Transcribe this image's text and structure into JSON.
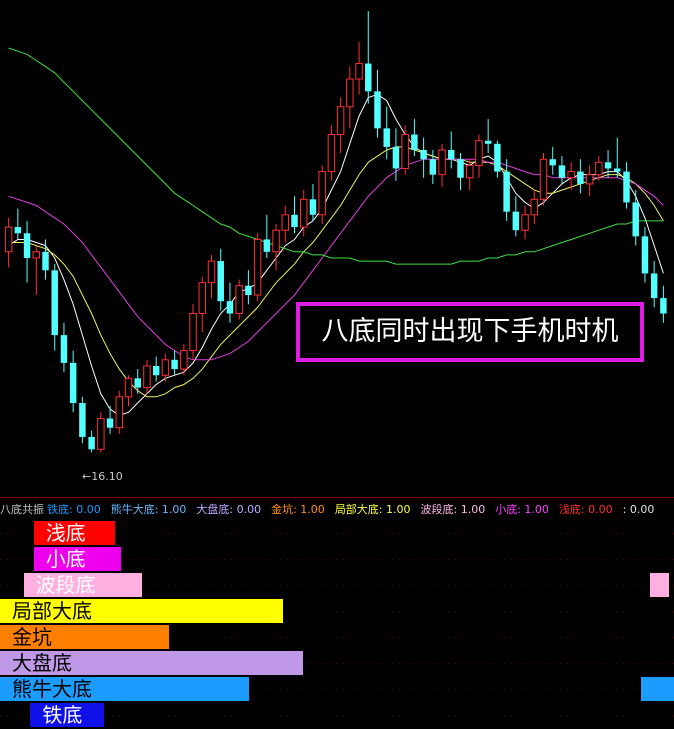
{
  "chart_data": {
    "type": "candlestick",
    "y_range": [
      15.4,
      30.5
    ],
    "candles": [
      [
        22.6,
        23.7,
        22.1,
        23.4
      ],
      [
        23.4,
        24.0,
        23.0,
        23.2
      ],
      [
        23.2,
        23.6,
        21.6,
        22.4
      ],
      [
        22.4,
        22.8,
        21.2,
        22.6
      ],
      [
        22.6,
        23.0,
        21.7,
        22.0
      ],
      [
        22.0,
        22.2,
        19.4,
        19.9
      ],
      [
        19.9,
        20.3,
        18.7,
        19.0
      ],
      [
        19.0,
        19.4,
        17.4,
        17.7
      ],
      [
        17.7,
        17.9,
        16.4,
        16.6
      ],
      [
        16.6,
        16.8,
        16.1,
        16.2
      ],
      [
        16.2,
        17.4,
        16.1,
        17.2
      ],
      [
        17.2,
        17.6,
        16.7,
        16.9
      ],
      [
        16.9,
        18.1,
        16.7,
        17.9
      ],
      [
        17.9,
        18.6,
        17.6,
        18.5
      ],
      [
        18.5,
        18.8,
        18.0,
        18.2
      ],
      [
        18.2,
        19.1,
        18.0,
        18.9
      ],
      [
        18.9,
        19.2,
        18.4,
        18.6
      ],
      [
        18.6,
        19.3,
        18.4,
        19.1
      ],
      [
        19.1,
        19.4,
        18.6,
        18.8
      ],
      [
        18.8,
        19.6,
        18.6,
        19.4
      ],
      [
        19.4,
        20.9,
        19.1,
        20.6
      ],
      [
        20.6,
        21.8,
        20.0,
        21.6
      ],
      [
        21.6,
        22.5,
        21.1,
        22.3
      ],
      [
        22.3,
        22.7,
        20.7,
        21.0
      ],
      [
        21.0,
        21.6,
        20.3,
        20.6
      ],
      [
        20.6,
        21.7,
        20.4,
        21.5
      ],
      [
        21.5,
        22.0,
        20.9,
        21.2
      ],
      [
        21.2,
        23.2,
        21.0,
        23.0
      ],
      [
        23.0,
        23.8,
        22.4,
        22.6
      ],
      [
        22.6,
        23.5,
        22.0,
        23.3
      ],
      [
        23.3,
        24.1,
        22.9,
        23.8
      ],
      [
        23.8,
        24.4,
        23.2,
        23.4
      ],
      [
        23.4,
        24.6,
        23.1,
        24.3
      ],
      [
        24.3,
        24.8,
        23.6,
        23.8
      ],
      [
        23.8,
        25.4,
        23.5,
        25.2
      ],
      [
        25.2,
        26.7,
        24.9,
        26.4
      ],
      [
        26.4,
        27.6,
        25.8,
        27.3
      ],
      [
        27.3,
        28.6,
        26.6,
        28.2
      ],
      [
        28.2,
        29.4,
        27.7,
        28.7
      ],
      [
        28.7,
        30.4,
        27.4,
        27.8
      ],
      [
        27.8,
        28.5,
        26.3,
        26.6
      ],
      [
        26.6,
        27.3,
        25.6,
        26.0
      ],
      [
        26.0,
        26.6,
        24.9,
        25.3
      ],
      [
        25.3,
        26.7,
        25.1,
        26.4
      ],
      [
        26.4,
        26.9,
        25.7,
        25.9
      ],
      [
        25.9,
        26.3,
        25.0,
        25.6
      ],
      [
        25.6,
        25.9,
        24.8,
        25.1
      ],
      [
        25.1,
        26.1,
        24.7,
        25.9
      ],
      [
        25.9,
        26.5,
        25.3,
        25.6
      ],
      [
        25.6,
        25.8,
        24.6,
        25.0
      ],
      [
        25.0,
        25.6,
        24.6,
        25.4
      ],
      [
        25.4,
        26.4,
        25.0,
        26.2
      ],
      [
        26.2,
        26.9,
        25.8,
        26.1
      ],
      [
        26.1,
        26.2,
        25.0,
        25.2
      ],
      [
        25.2,
        25.6,
        23.6,
        23.9
      ],
      [
        23.9,
        24.4,
        23.1,
        23.3
      ],
      [
        23.3,
        24.1,
        23.0,
        23.8
      ],
      [
        23.8,
        24.6,
        23.5,
        24.3
      ],
      [
        24.3,
        25.8,
        24.1,
        25.6
      ],
      [
        25.6,
        26.0,
        25.1,
        25.4
      ],
      [
        25.4,
        25.7,
        24.8,
        25.0
      ],
      [
        25.0,
        25.5,
        24.6,
        25.2
      ],
      [
        25.2,
        25.6,
        24.5,
        24.8
      ],
      [
        24.8,
        25.4,
        24.4,
        25.1
      ],
      [
        25.1,
        25.7,
        24.9,
        25.5
      ],
      [
        25.5,
        25.9,
        25.0,
        25.3
      ],
      [
        25.3,
        26.3,
        25.0,
        25.2
      ],
      [
        25.2,
        25.5,
        24.0,
        24.2
      ],
      [
        24.2,
        24.6,
        22.8,
        23.1
      ],
      [
        23.1,
        23.4,
        21.6,
        21.9
      ],
      [
        21.9,
        22.3,
        20.8,
        21.1
      ],
      [
        21.1,
        21.5,
        20.3,
        20.6
      ]
    ],
    "ma_lines": [
      {
        "color": "#ffffff",
        "values": [
          22.8,
          23.0,
          23.0,
          22.9,
          22.8,
          22.4,
          21.7,
          20.9,
          19.9,
          18.9,
          18.0,
          17.5,
          17.3,
          17.4,
          17.7,
          18.0,
          18.3,
          18.5,
          18.6,
          18.7,
          19.0,
          19.5,
          20.1,
          20.6,
          20.9,
          21.3,
          21.4,
          21.6,
          22.0,
          22.4,
          22.8,
          23.0,
          23.4,
          23.6,
          24.0,
          24.6,
          25.2,
          26.1,
          27.0,
          27.6,
          27.7,
          27.5,
          26.9,
          26.4,
          26.0,
          25.8,
          25.7,
          25.6,
          25.6,
          25.5,
          25.4,
          25.6,
          25.7,
          25.5,
          25.0,
          24.5,
          24.2,
          24.0,
          24.2,
          24.5,
          24.8,
          25.0,
          25.1,
          25.1,
          25.1,
          25.2,
          25.2,
          24.9,
          24.4,
          23.7,
          22.8,
          21.9
        ]
      },
      {
        "color": "#f0f060",
        "values": [
          22.9,
          22.9,
          22.9,
          22.8,
          22.7,
          22.5,
          22.2,
          21.8,
          21.2,
          20.6,
          19.9,
          19.3,
          18.8,
          18.4,
          18.1,
          17.9,
          17.9,
          18.0,
          18.2,
          18.3,
          18.5,
          18.8,
          19.2,
          19.6,
          19.9,
          20.2,
          20.5,
          20.8,
          21.2,
          21.6,
          21.9,
          22.2,
          22.6,
          22.9,
          23.3,
          23.7,
          24.1,
          24.6,
          25.1,
          25.5,
          25.7,
          25.9,
          26.0,
          26.0,
          25.9,
          25.8,
          25.7,
          25.6,
          25.6,
          25.6,
          25.5,
          25.5,
          25.5,
          25.4,
          25.2,
          25.0,
          24.8,
          24.6,
          24.5,
          24.5,
          24.6,
          24.7,
          24.8,
          24.9,
          25.0,
          25.1,
          25.1,
          25.0,
          24.8,
          24.5,
          24.1,
          23.6
        ]
      },
      {
        "color": "#e040e0",
        "values": [
          24.4,
          24.3,
          24.2,
          24.1,
          23.9,
          23.7,
          23.5,
          23.2,
          22.9,
          22.5,
          22.1,
          21.7,
          21.3,
          20.9,
          20.5,
          20.2,
          19.9,
          19.6,
          19.4,
          19.2,
          19.1,
          19.1,
          19.1,
          19.2,
          19.3,
          19.5,
          19.7,
          20.0,
          20.3,
          20.6,
          20.9,
          21.2,
          21.6,
          22.0,
          22.4,
          22.8,
          23.2,
          23.6,
          24.0,
          24.4,
          24.7,
          25.0,
          25.2,
          25.4,
          25.5,
          25.6,
          25.6,
          25.6,
          25.6,
          25.6,
          25.6,
          25.6,
          25.5,
          25.5,
          25.4,
          25.3,
          25.2,
          25.1,
          25.1,
          25.0,
          25.0,
          25.0,
          25.0,
          25.0,
          25.0,
          25.0,
          25.0,
          24.9,
          24.8,
          24.6,
          24.4,
          24.1
        ]
      },
      {
        "color": "#40e040",
        "values": [
          29.2,
          29.1,
          29.0,
          28.8,
          28.6,
          28.4,
          28.1,
          27.8,
          27.5,
          27.2,
          26.9,
          26.6,
          26.3,
          26.0,
          25.7,
          25.4,
          25.1,
          24.8,
          24.5,
          24.3,
          24.1,
          23.9,
          23.7,
          23.5,
          23.4,
          23.2,
          23.1,
          23.0,
          22.9,
          22.8,
          22.7,
          22.6,
          22.6,
          22.5,
          22.5,
          22.4,
          22.4,
          22.4,
          22.3,
          22.3,
          22.3,
          22.3,
          22.2,
          22.2,
          22.2,
          22.2,
          22.2,
          22.2,
          22.2,
          22.3,
          22.3,
          22.3,
          22.4,
          22.4,
          22.5,
          22.5,
          22.6,
          22.6,
          22.7,
          22.8,
          22.9,
          23.0,
          23.1,
          23.2,
          23.3,
          23.4,
          23.5,
          23.5,
          23.6,
          23.6,
          23.6,
          23.6
        ]
      }
    ],
    "low_annotation": "←16.10",
    "up_color": "#ff3030",
    "down_color": "#54ffff",
    "sub_bars": [
      {
        "label": "浅底",
        "color": "#ff0000",
        "start": 0.05,
        "end": 0.17,
        "label_color": "#ffffff"
      },
      {
        "label": "小底",
        "color": "#ee00ee",
        "start": 0.05,
        "end": 0.18,
        "label_color": "#ffffff"
      },
      {
        "label": "波段底",
        "color": "#ffb0e0",
        "start": 0.035,
        "end": 0.21,
        "label_color": "#ffffff"
      },
      {
        "label": "局部大底",
        "color": "#ffff00",
        "start": 0.0,
        "end": 0.42,
        "label_color": "#000000"
      },
      {
        "label": "金坑",
        "color": "#ff8000",
        "start": 0.0,
        "end": 0.25,
        "label_color": "#000000"
      },
      {
        "label": "大盘底",
        "color": "#c098e8",
        "start": 0.0,
        "end": 0.45,
        "label_color": "#000000"
      },
      {
        "label": "熊牛大底",
        "color": "#1c9cff",
        "start": 0.0,
        "end": 0.37,
        "label_color": "#000000"
      },
      {
        "label": "铁底",
        "color": "#1010e8",
        "start": 0.045,
        "end": 0.155,
        "label_color": "#ffffff"
      }
    ],
    "right_marks": [
      {
        "row": 2,
        "color": "#ffb0e0"
      },
      {
        "row": 6,
        "color": "#1c9cff"
      }
    ]
  },
  "annotation": {
    "text": "八底同时出现下手机时机",
    "border_color": "#e11be6"
  },
  "legend": [
    {
      "text": "八底共振",
      "color": "#c0c0c0"
    },
    {
      "text": "铁底: 0.00",
      "color": "#1c9cff"
    },
    {
      "text": "熊牛大底: 1.00",
      "color": "#6ab8ff"
    },
    {
      "text": "大盘底: 0.00",
      "color": "#c0a8ff"
    },
    {
      "text": "金坑: 1.00",
      "color": "#ff9020"
    },
    {
      "text": "局部大底: 1.00",
      "color": "#ffff40"
    },
    {
      "text": "波段底: 1.00",
      "color": "#ffb8e8"
    },
    {
      "text": "小底: 1.00",
      "color": "#ff40ff"
    },
    {
      "text": "浅底: 0.00",
      "color": "#ff3030"
    },
    {
      "text": ": 0.00",
      "color": "#e0e0e0"
    }
  ]
}
